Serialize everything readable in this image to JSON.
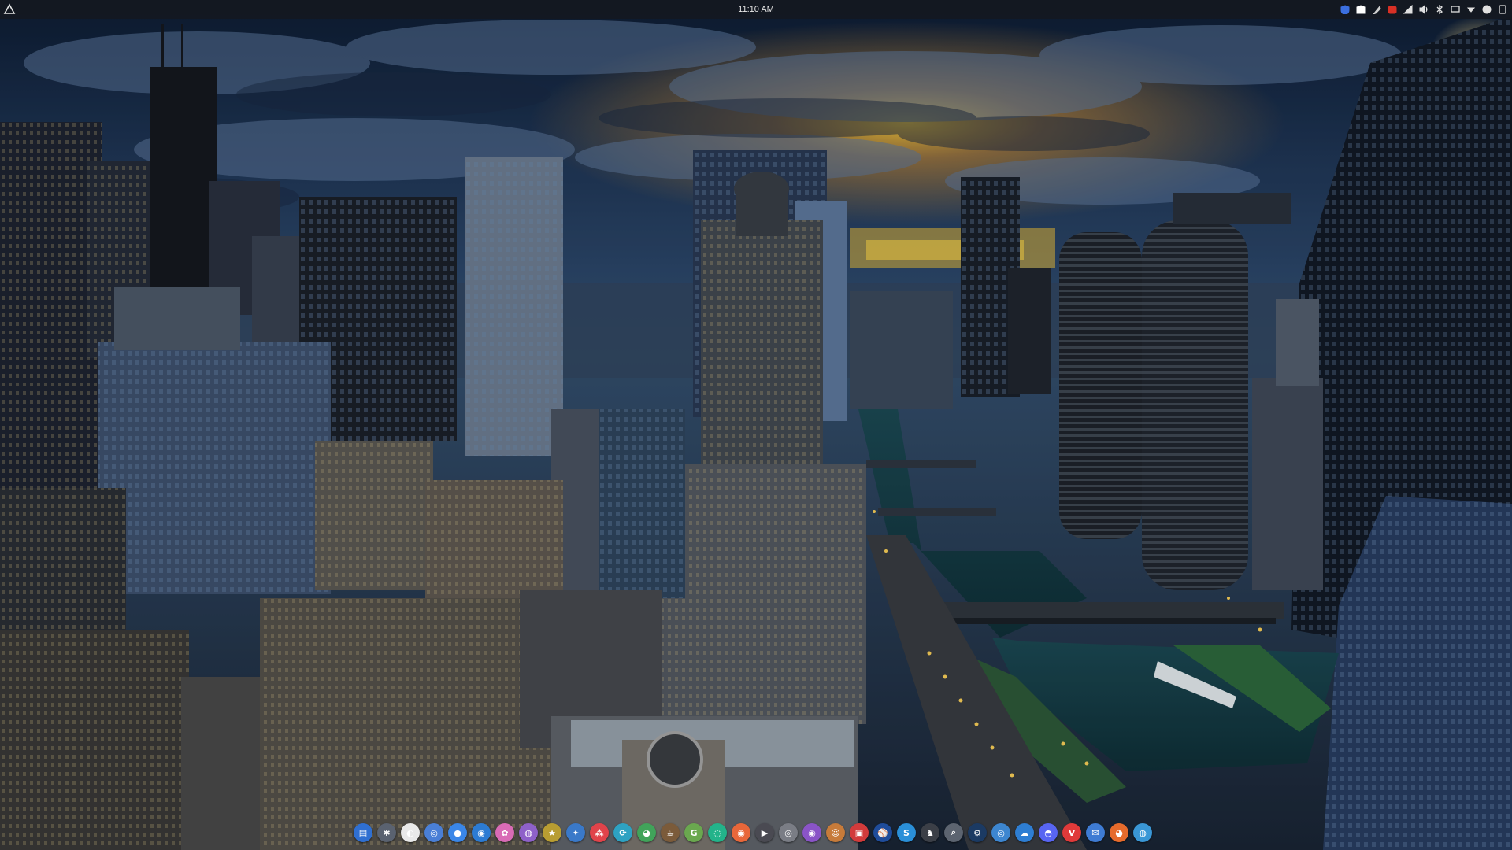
{
  "top_panel": {
    "clock": "11:10 AM",
    "launcher_icon": "arch-triangle-icon",
    "tray": [
      {
        "name": "shield-icon",
        "color": "#3b6fe0"
      },
      {
        "name": "dropbox-icon",
        "color": "#ffffff"
      },
      {
        "name": "feather-icon",
        "color": "#cfcfcf"
      },
      {
        "name": "mail-icon",
        "color": "#d93025"
      },
      {
        "name": "network-icon",
        "color": "#e0e0e0"
      },
      {
        "name": "volume-icon",
        "color": "#e0e0e0"
      },
      {
        "name": "bluetooth-icon",
        "color": "#e0e0e0"
      },
      {
        "name": "display-icon",
        "color": "#e0e0e0"
      },
      {
        "name": "dropdown-icon",
        "color": "#e0e0e0"
      },
      {
        "name": "pinwheel-icon",
        "color": "#e0e0e0"
      },
      {
        "name": "power-icon",
        "color": "#e0e0e0"
      }
    ]
  },
  "dock": {
    "items": [
      {
        "name": "file-manager-icon",
        "color": "#2f6fd1",
        "glyph": "▤"
      },
      {
        "name": "settings-icon",
        "color": "#5a6270",
        "glyph": "✱"
      },
      {
        "name": "compass-icon",
        "color": "#e9e9e9",
        "glyph": "◐"
      },
      {
        "name": "globe-icon",
        "color": "#4a7fd6",
        "glyph": "◎"
      },
      {
        "name": "chromium-icon",
        "color": "#3a86e8",
        "glyph": "●"
      },
      {
        "name": "browser-icon",
        "color": "#2c7bd3",
        "glyph": "◉"
      },
      {
        "name": "photos-icon",
        "color": "#d96bb6",
        "glyph": "✿"
      },
      {
        "name": "color-picker-icon",
        "color": "#8e61c9",
        "glyph": "◍"
      },
      {
        "name": "gold-app-icon",
        "color": "#b89d32",
        "glyph": "★"
      },
      {
        "name": "star-icon",
        "color": "#3a79c9",
        "glyph": "✦"
      },
      {
        "name": "mixer-icon",
        "color": "#e0434a",
        "glyph": "⁂"
      },
      {
        "name": "update-icon",
        "color": "#2ea2c2",
        "glyph": "⟳"
      },
      {
        "name": "chrome-icon",
        "color": "#41a35a",
        "glyph": "◕"
      },
      {
        "name": "coffee-icon",
        "color": "#7b5b3a",
        "glyph": "☕"
      },
      {
        "name": "brand-g-icon",
        "color": "#6aa84f",
        "glyph": "G"
      },
      {
        "name": "chat-icon",
        "color": "#23b38a",
        "glyph": "◌"
      },
      {
        "name": "camera-icon",
        "color": "#e8673a",
        "glyph": "◉"
      },
      {
        "name": "play-icon",
        "color": "#4a4a52",
        "glyph": "▶"
      },
      {
        "name": "disc-icon",
        "color": "#7a7d85",
        "glyph": "◎"
      },
      {
        "name": "radio-icon",
        "color": "#8a54c7",
        "glyph": "◉"
      },
      {
        "name": "emoji-icon",
        "color": "#c77b3a",
        "glyph": "☺"
      },
      {
        "name": "video-icon",
        "color": "#d23b3b",
        "glyph": "▣"
      },
      {
        "name": "baseball-icon",
        "color": "#1f4c9a",
        "glyph": "⚾"
      },
      {
        "name": "skype-icon",
        "color": "#2a8fd8",
        "glyph": "S"
      },
      {
        "name": "helmet-icon",
        "color": "#3b3f47",
        "glyph": "♞"
      },
      {
        "name": "search-icon",
        "color": "#5c6470",
        "glyph": "⌕"
      },
      {
        "name": "steam-icon",
        "color": "#1b3a63",
        "glyph": "⚙"
      },
      {
        "name": "web-icon",
        "color": "#3d86d0",
        "glyph": "◎"
      },
      {
        "name": "cloud-icon",
        "color": "#2e7ed3",
        "glyph": "☁"
      },
      {
        "name": "discord-icon",
        "color": "#5865f2",
        "glyph": "◓"
      },
      {
        "name": "vivaldi-icon",
        "color": "#e03a3a",
        "glyph": "V"
      },
      {
        "name": "mail-client-icon",
        "color": "#3e7bd3",
        "glyph": "✉"
      },
      {
        "name": "firefox-icon",
        "color": "#e66b2c",
        "glyph": "◕"
      },
      {
        "name": "world-icon",
        "color": "#3a97d6",
        "glyph": "◍"
      }
    ]
  }
}
